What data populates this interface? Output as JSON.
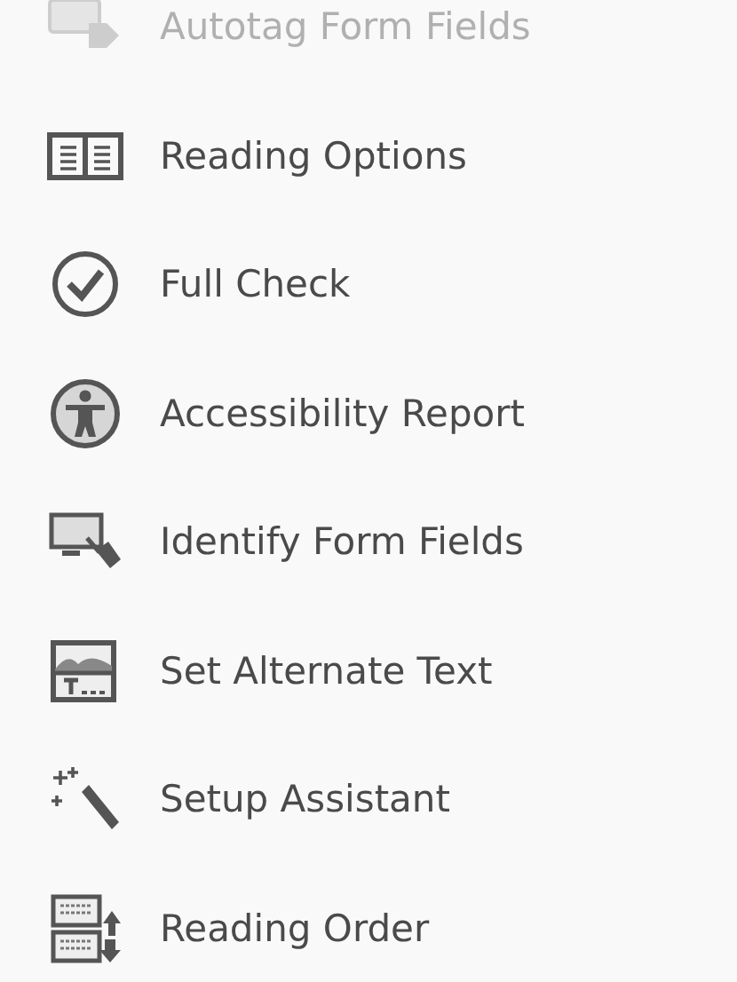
{
  "tools": [
    {
      "label": "Autotag Form Fields",
      "kind": "autotag",
      "disabled": true
    },
    {
      "label": "Reading Options",
      "kind": "book",
      "disabled": false
    },
    {
      "label": "Full Check",
      "kind": "check",
      "disabled": false
    },
    {
      "label": "Accessibility Report",
      "kind": "accessibility",
      "disabled": false
    },
    {
      "label": "Identify Form Fields",
      "kind": "identify",
      "disabled": false
    },
    {
      "label": "Set Alternate Text",
      "kind": "alttext",
      "disabled": false
    },
    {
      "label": "Setup Assistant",
      "kind": "wand",
      "disabled": false
    },
    {
      "label": "Reading Order",
      "kind": "order",
      "disabled": false
    }
  ]
}
